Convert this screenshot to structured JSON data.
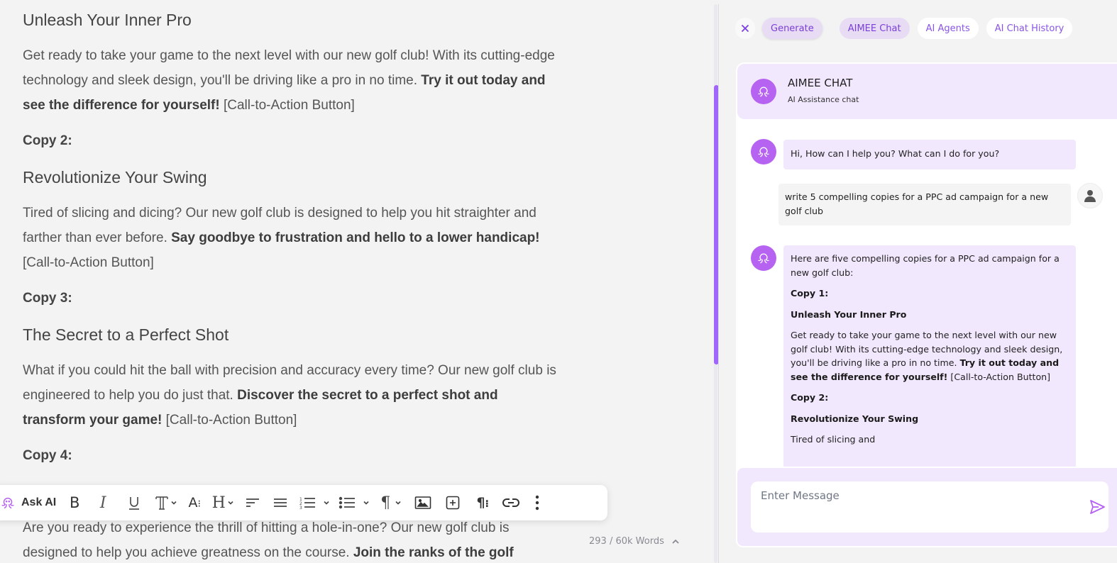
{
  "editor": {
    "blocks": {
      "h1": "Unleash Your Inner Pro",
      "p1_normal": "Get ready to take your game to the next level with our new golf club! With its cutting-edge technology and sleek design, you'll be driving like a pro in no time. ",
      "p1_bold": "Try it out today and see the difference for yourself!",
      "p1_tail": " [Call-to-Action Button]",
      "c2": "Copy 2:",
      "h2": "Revolutionize Your Swing",
      "p2_normal": "Tired of slicing and dicing? Our new golf club is designed to help you hit straighter and farther than ever before. ",
      "p2_bold": "Say goodbye to frustration and hello to a lower handicap!",
      "p2_tail": " [Call-to-Action Button]",
      "c3": "Copy 3:",
      "h3": "The Secret to a Perfect Shot",
      "p3_normal": "What if you could hit the ball with precision and accuracy every time? Our new golf club is engineered to help you do just that. ",
      "p3_bold": "Discover the secret to a perfect shot and transform your game!",
      "p3_tail": " [Call-to-Action Button]",
      "c4": "Copy 4:",
      "p5_normal": "Are you ready to experience the thrill of hitting a hole-in-one? Our new golf club is designed to help you achieve greatness on the course. ",
      "p5_bold": "Join the ranks of the golf"
    },
    "toolbar": {
      "ask_ai_label": "Ask AI",
      "items": [
        "ai-octopus",
        "bold",
        "italic",
        "underline",
        "font-type",
        "font-size",
        "heading",
        "align-left",
        "align-justify",
        "ordered-list",
        "bullet-list",
        "paragraph",
        "image",
        "insert-block",
        "paragraph-format",
        "link",
        "more"
      ]
    },
    "word_count": "293 / 60k Words",
    "scroll_position": 0.15
  },
  "panel": {
    "tabs": {
      "close": "×",
      "generate": "Generate",
      "aimee_chat": "AIMEE Chat",
      "ai_agents": "AI Agents",
      "ai_chat_history": "AI Chat History",
      "active": "AIMEE Chat"
    },
    "header": {
      "title": "AIMEE CHAT",
      "subtitle": "AI Assistance chat"
    },
    "messages": [
      {
        "role": "bot",
        "text": "Hi, How can I help you? What can I do for you?"
      },
      {
        "role": "user",
        "text": "write 5 compelling copies for a PPC ad campaign for a new golf club"
      },
      {
        "role": "bot",
        "intro": "Here are five compelling copies for a PPC ad campaign for a new golf club:",
        "copy1_label": "Copy 1:",
        "copy1_title": "Unleash Your Inner Pro",
        "copy1_normal": "Get ready to take your game to the next level with our new golf club! With its cutting-edge technology and sleek design, you'll be driving like a pro in no time. ",
        "copy1_bold": "Try it out today and see the difference for yourself!",
        "copy1_tail": " [Call-to-Action Button]",
        "copy2_label": "Copy 2:",
        "copy2_title": "Revolutionize Your Swing",
        "copy2_partial": "Tired of slicing and"
      }
    ],
    "composer": {
      "placeholder": "Enter Message",
      "value": ""
    }
  },
  "colors": {
    "accent": "#a066fb",
    "accent_dark": "#7b3fd8",
    "bot_avatar": "#b763f2",
    "bubble_bot": "#f2e8fe",
    "bubble_user": "#f4f4f4",
    "background": "#f3f3f3"
  }
}
